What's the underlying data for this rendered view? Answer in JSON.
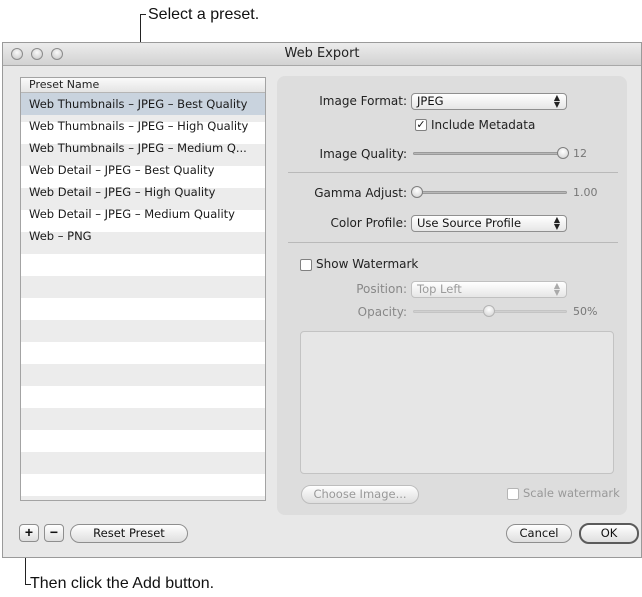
{
  "callouts": {
    "top": "Select a preset.",
    "bottom": "Then click the Add button."
  },
  "window": {
    "title": "Web Export"
  },
  "presets": {
    "header": "Preset Name",
    "items": [
      "Web Thumbnails – JPEG – Best Quality",
      "Web Thumbnails – JPEG – High Quality",
      "Web Thumbnails – JPEG – Medium Q...",
      "Web Detail – JPEG – Best Quality",
      "Web Detail – JPEG – High Quality",
      "Web Detail – JPEG – Medium Quality",
      "Web – PNG"
    ],
    "selected_index": 0
  },
  "settings": {
    "image_format": {
      "label": "Image Format:",
      "value": "JPEG"
    },
    "include_metadata": {
      "label": "Include Metadata",
      "checked": true
    },
    "image_quality": {
      "label": "Image Quality:",
      "value": "12"
    },
    "gamma_adjust": {
      "label": "Gamma Adjust:",
      "value": "1.00"
    },
    "color_profile": {
      "label": "Color Profile:",
      "value": "Use Source Profile"
    },
    "show_watermark": {
      "label": "Show Watermark",
      "checked": false
    },
    "position": {
      "label": "Position:",
      "value": "Top Left"
    },
    "opacity": {
      "label": "Opacity:",
      "value": "50%"
    },
    "choose_image": "Choose Image...",
    "scale_watermark": {
      "label": "Scale watermark",
      "checked": false
    }
  },
  "buttons": {
    "add": "+",
    "remove": "−",
    "reset_preset": "Reset Preset",
    "cancel": "Cancel",
    "ok": "OK"
  }
}
